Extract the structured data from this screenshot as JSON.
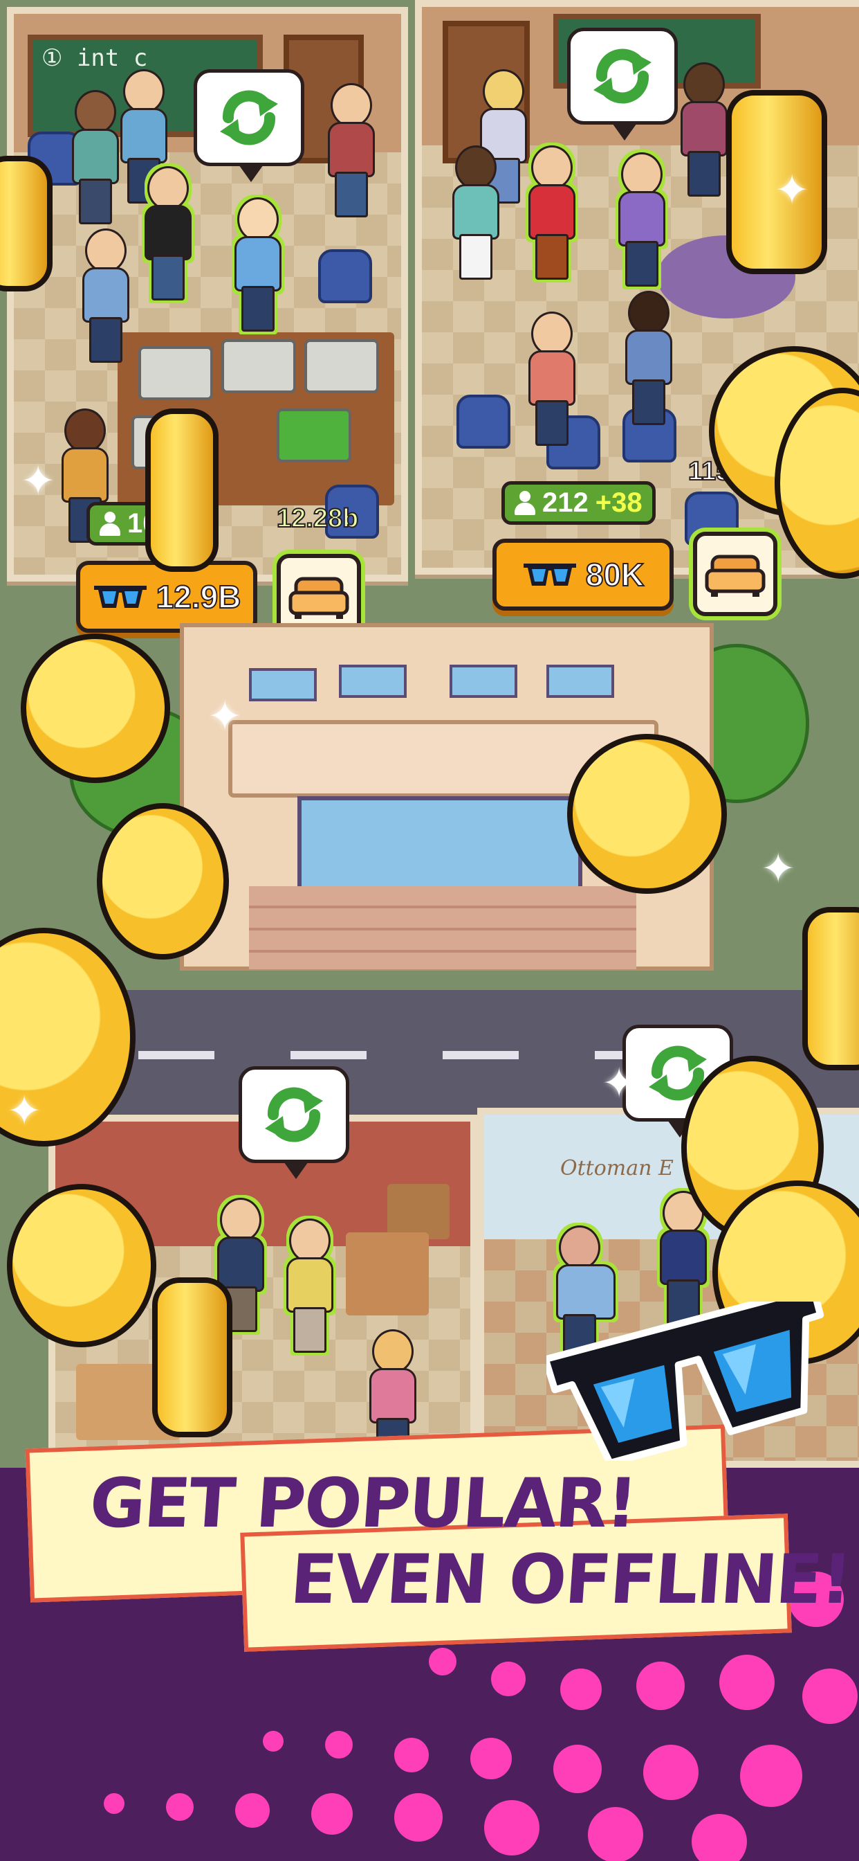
{
  "rooms": {
    "room_left": {
      "chalkboard_text": "① int c",
      "members_value": "10",
      "income_tag": "12.28b",
      "upgrade_price": "12.9B"
    },
    "room_right": {
      "members_value": "212",
      "members_plus": "+38",
      "upgrade_price": "80K",
      "income_tag": "115"
    },
    "room_bottom_right": {
      "sign_text": "Ottoman E"
    }
  },
  "icons": {
    "refresh": "refresh-arrows-icon",
    "glasses": "sunglasses-icon",
    "sofa": "sofa-icon",
    "person": "person-icon",
    "coin": "gold-coin-icon"
  },
  "banner": {
    "line1": "GET POPULAR!",
    "line2": "EVEN OFFLINE!"
  },
  "colors": {
    "accent_orange": "#f7a516",
    "accent_green": "#a8e33a",
    "banner_text": "#5b2377",
    "banner_dots": "#ff3fb8"
  }
}
